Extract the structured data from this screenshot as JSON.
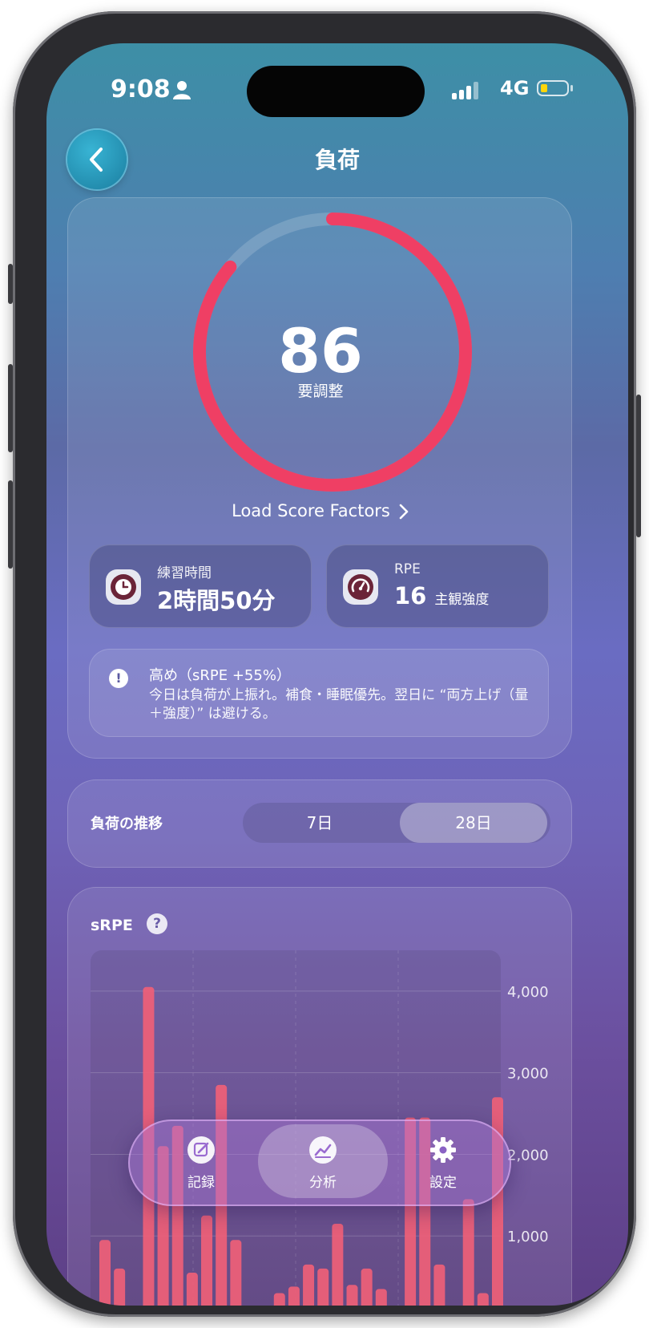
{
  "status_bar": {
    "time": "9:08",
    "network": "4G"
  },
  "header": {
    "title": "負荷"
  },
  "score": {
    "value": "86",
    "label": "要調整",
    "fraction": 0.86,
    "color": "#ef3f64"
  },
  "factors_link": {
    "label": "Load Score Factors"
  },
  "tiles": {
    "duration": {
      "label": "練習時間",
      "value": "2時間50分"
    },
    "rpe": {
      "label": "RPE",
      "value": "16",
      "sub": "主観強度"
    }
  },
  "notice": {
    "heading": "高め（sRPE +55%）",
    "body": "今日は負荷が上振れ。補食・睡眠優先。翌日に “両方上げ（量＋強度）” は避ける。"
  },
  "trend": {
    "title": "負荷の推移",
    "options": [
      "7日",
      "28日"
    ],
    "selected": "28日"
  },
  "chart_title": "sRPE",
  "help_glyph": "?",
  "chart_data": {
    "type": "bar",
    "title": "sRPE",
    "y_ticks": [
      "4,000",
      "3,000",
      "2,000",
      "1,000"
    ],
    "ylim": [
      0,
      4500
    ],
    "values": [
      950,
      600,
      0,
      4050,
      2100,
      2350,
      550,
      1250,
      2850,
      950,
      0,
      0,
      300,
      380,
      650,
      600,
      1150,
      400,
      600,
      350,
      0,
      2450,
      2450,
      650,
      0,
      1450,
      300,
      2700
    ],
    "color": "#ef5f77"
  },
  "tabbar": {
    "tabs": [
      {
        "label": "記録",
        "icon": "edit-icon",
        "active": false
      },
      {
        "label": "分析",
        "icon": "chart-icon",
        "active": true
      },
      {
        "label": "設定",
        "icon": "gear-icon",
        "active": false
      }
    ]
  }
}
